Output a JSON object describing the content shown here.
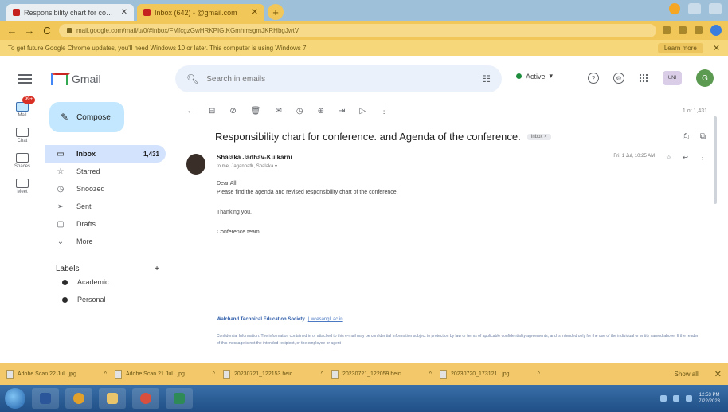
{
  "browser": {
    "tabs": [
      {
        "label": "Responsibility chart for conferen",
        "close": "✕"
      },
      {
        "label": "Inbox (642) - @gmail.com",
        "close": "✕"
      }
    ],
    "new_tab": "+",
    "address": "mail.google.com/mail/u/0/#inbox/FMfcgzGwHRKPIGtKGmhmsgmJKRHbgJwtV",
    "infobar_text": "To get future Google Chrome updates, you'll need Windows 10 or later. This computer is using Windows 7.",
    "infobar_link": "Learn more",
    "infobar_close": "✕",
    "nav": {
      "back": "←",
      "forward": "→",
      "reload": "C"
    }
  },
  "gmail": {
    "logo_text": "Gmail",
    "search_placeholder": "Search in emails",
    "status": "Active",
    "org_badge": "UNI",
    "avatar_letter": "G"
  },
  "rail": [
    {
      "label": "Mail",
      "badge": "99+"
    },
    {
      "label": "Chat"
    },
    {
      "label": "Spaces"
    },
    {
      "label": "Meet"
    }
  ],
  "sidebar": {
    "compose_label": "Compose",
    "items": [
      {
        "label": "Inbox",
        "count": "1,431",
        "glyph": "▭"
      },
      {
        "label": "Starred",
        "count": "",
        "glyph": "☆"
      },
      {
        "label": "Snoozed",
        "count": "",
        "glyph": "◷"
      },
      {
        "label": "Sent",
        "count": "",
        "glyph": "➢"
      },
      {
        "label": "Drafts",
        "count": "",
        "glyph": "▢"
      },
      {
        "label": "More",
        "count": "",
        "glyph": "⌄"
      }
    ],
    "labels_title": "Labels",
    "labels_add": "+",
    "labels": [
      {
        "label": "Academic"
      },
      {
        "label": "Personal"
      }
    ]
  },
  "message": {
    "pager": "1 of 1,431",
    "subject": "Responsibility chart for conference. and Agenda of the conference.",
    "inbox_chip": "Inbox ×",
    "sender_name": "Shalaka Jadhav-Kulkarni",
    "sender_to": "to me, Jagannath, Shalaka ▾",
    "date": "Fri, 1 Jul, 10:25 AM",
    "greeting": "Dear All,",
    "line1": "Please find the agenda and revised responsibility chart of the conference.",
    "thanks": "Thanking you,",
    "team": "Conference team",
    "sig_org": "Walchand Technical Education Society",
    "sig_link": "| wcesangli.ac.in",
    "disclaimer": "Confidential Information: The information contained in or attached to this e-mail may be confidential information subject to protection by law or terms of applicable confidentiality agreements, and is intended only for the use of the individual or entity named above. If the reader of this message is not the intended recipient, or the employee or agent"
  },
  "downloads": {
    "items": [
      {
        "label": "Adobe Scan 22 Jul...jpg"
      },
      {
        "label": "Adobe Scan 21 Jul...jpg"
      },
      {
        "label": "20230721_122153.heic"
      },
      {
        "label": "20230721_122059.heic"
      },
      {
        "label": "20230720_173121...jpg"
      }
    ],
    "show_all": "Show all",
    "close": "✕"
  },
  "taskbar": {
    "clock_time": "12:53 PM",
    "clock_date": "7/22/2023"
  },
  "colors": {
    "tabstrip": "#9fc0d9",
    "addressbar": "#f1c75a",
    "compose": "#c2e7ff",
    "active_nav": "#d3e3fd",
    "status_green": "#1e8e3e"
  }
}
